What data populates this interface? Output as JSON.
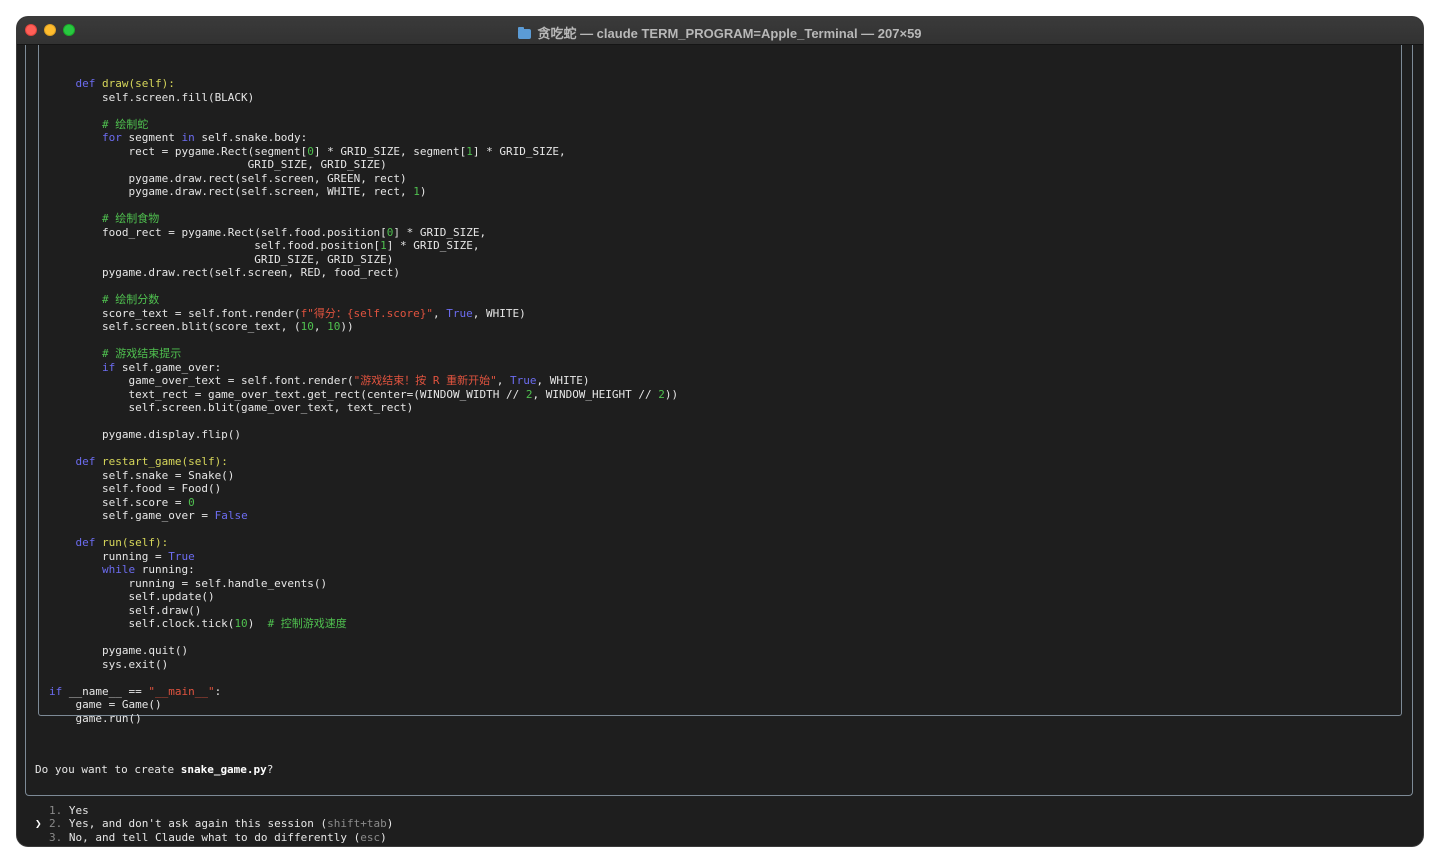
{
  "window": {
    "title": "贪吃蛇 — claude TERM_PROGRAM=Apple_Terminal — 207×59"
  },
  "code": [
    [
      [
        "    "
      ],
      [
        "def ",
        "kw"
      ],
      [
        "draw(self):",
        "fn"
      ]
    ],
    [
      [
        "        self.screen.fill(BLACK)"
      ]
    ],
    [
      [
        ""
      ]
    ],
    [
      [
        "        "
      ],
      [
        "# 绘制蛇",
        "cm"
      ]
    ],
    [
      [
        "        "
      ],
      [
        "for",
        "kw"
      ],
      [
        " segment "
      ],
      [
        "in",
        "kw"
      ],
      [
        " self.snake.body:"
      ]
    ],
    [
      [
        "            rect = pygame.Rect(segment["
      ],
      [
        "0",
        "num"
      ],
      [
        "] * GRID_SIZE, segment["
      ],
      [
        "1",
        "num"
      ],
      [
        "] * GRID_SIZE,"
      ]
    ],
    [
      [
        "                              GRID_SIZE, GRID_SIZE)"
      ]
    ],
    [
      [
        "            pygame.draw.rect(self.screen, GREEN, rect)"
      ]
    ],
    [
      [
        "            pygame.draw.rect(self.screen, WHITE, rect, "
      ],
      [
        "1",
        "num"
      ],
      [
        ")"
      ]
    ],
    [
      [
        ""
      ]
    ],
    [
      [
        "        "
      ],
      [
        "# 绘制食物",
        "cm"
      ]
    ],
    [
      [
        "        food_rect = pygame.Rect(self.food.position["
      ],
      [
        "0",
        "num"
      ],
      [
        "] * GRID_SIZE,"
      ]
    ],
    [
      [
        "                               self.food.position["
      ],
      [
        "1",
        "num"
      ],
      [
        "] * GRID_SIZE,"
      ]
    ],
    [
      [
        "                               GRID_SIZE, GRID_SIZE)"
      ]
    ],
    [
      [
        "        pygame.draw.rect(self.screen, RED, food_rect)"
      ]
    ],
    [
      [
        ""
      ]
    ],
    [
      [
        "        "
      ],
      [
        "# 绘制分数",
        "cm"
      ]
    ],
    [
      [
        "        score_text = self.font.render("
      ],
      [
        "f\"得分：{self.score}\"",
        "str"
      ],
      [
        ", "
      ],
      [
        "True",
        "kw"
      ],
      [
        ", WHITE)"
      ]
    ],
    [
      [
        "        self.screen.blit(score_text, ("
      ],
      [
        "10",
        "num"
      ],
      [
        ", "
      ],
      [
        "10",
        "num"
      ],
      [
        "))"
      ]
    ],
    [
      [
        ""
      ]
    ],
    [
      [
        "        "
      ],
      [
        "# 游戏结束提示",
        "cm"
      ]
    ],
    [
      [
        "        "
      ],
      [
        "if",
        "kw"
      ],
      [
        " self.game_over:"
      ]
    ],
    [
      [
        "            game_over_text = self.font.render("
      ],
      [
        "\"游戏结束！按 R 重新开始\"",
        "str"
      ],
      [
        ", "
      ],
      [
        "True",
        "kw"
      ],
      [
        ", WHITE)"
      ]
    ],
    [
      [
        "            text_rect = game_over_text.get_rect(center=(WINDOW_WIDTH // "
      ],
      [
        "2",
        "num"
      ],
      [
        ", WINDOW_HEIGHT // "
      ],
      [
        "2",
        "num"
      ],
      [
        "))"
      ]
    ],
    [
      [
        "            self.screen.blit(game_over_text, text_rect)"
      ]
    ],
    [
      [
        ""
      ]
    ],
    [
      [
        "        pygame.display.flip()"
      ]
    ],
    [
      [
        ""
      ]
    ],
    [
      [
        "    "
      ],
      [
        "def ",
        "kw"
      ],
      [
        "restart_game(self):",
        "fn"
      ]
    ],
    [
      [
        "        self.snake = Snake()"
      ]
    ],
    [
      [
        "        self.food = Food()"
      ]
    ],
    [
      [
        "        self.score = "
      ],
      [
        "0",
        "num"
      ]
    ],
    [
      [
        "        self.game_over = "
      ],
      [
        "False",
        "kw"
      ]
    ],
    [
      [
        ""
      ]
    ],
    [
      [
        "    "
      ],
      [
        "def ",
        "kw"
      ],
      [
        "run(self):",
        "fn"
      ]
    ],
    [
      [
        "        running = "
      ],
      [
        "True",
        "kw"
      ]
    ],
    [
      [
        "        "
      ],
      [
        "while",
        "kw"
      ],
      [
        " running:"
      ]
    ],
    [
      [
        "            running = self.handle_events()"
      ]
    ],
    [
      [
        "            self.update()"
      ]
    ],
    [
      [
        "            self.draw()"
      ]
    ],
    [
      [
        "            self.clock.tick("
      ],
      [
        "10",
        "num"
      ],
      [
        ")  "
      ],
      [
        "# 控制游戏速度",
        "cm"
      ]
    ],
    [
      [
        ""
      ]
    ],
    [
      [
        "        pygame.quit()"
      ]
    ],
    [
      [
        "        sys.exit()"
      ]
    ],
    [
      [
        ""
      ]
    ],
    [
      [
        "if",
        "kw"
      ],
      [
        " __name__ == "
      ],
      [
        "\"__main__\"",
        "str"
      ],
      [
        ":"
      ]
    ],
    [
      [
        "    game = Game()"
      ]
    ],
    [
      [
        "    game.run()"
      ]
    ]
  ],
  "prompt": {
    "question_prefix": "Do you want to create ",
    "filename": "snake_game.py",
    "question_suffix": "?",
    "cursor": "❯",
    "options": [
      {
        "index": "1.",
        "label": "Yes",
        "hint": ""
      },
      {
        "index": "2.",
        "label": "Yes, and don't ask again this session (",
        "hint": "shift+tab",
        "close": ")"
      },
      {
        "index": "3.",
        "label": "No, and tell Claude what to do differently (",
        "hint": "esc",
        "close": ")"
      }
    ],
    "selected": 1
  }
}
